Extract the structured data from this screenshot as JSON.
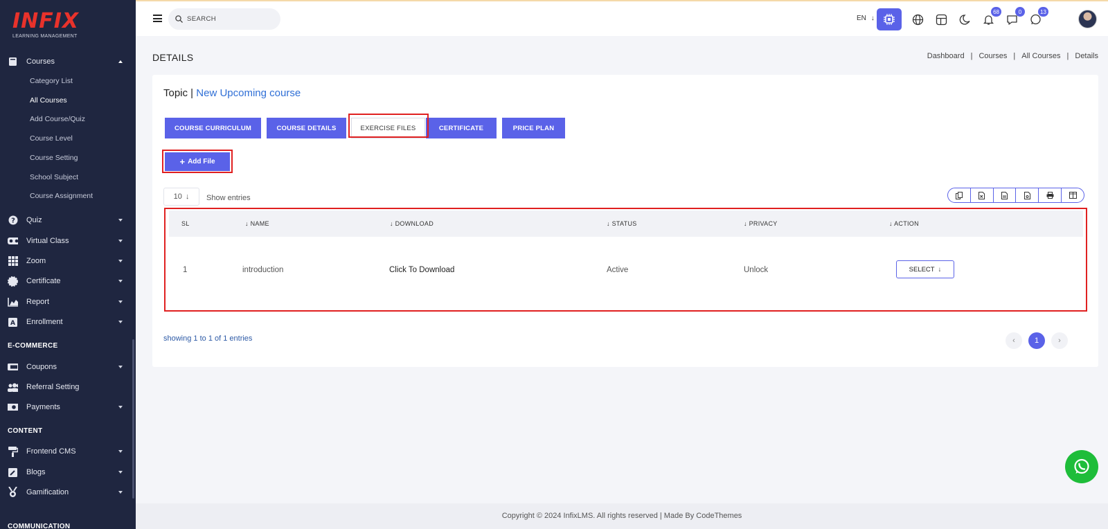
{
  "brand": {
    "logo_text": "INFIX",
    "logo_sub": "LEARNING MANAGEMENT"
  },
  "sidebar": {
    "courses": {
      "label": "Courses",
      "icon": "book-icon"
    },
    "course_sub": [
      "Category List",
      "All Courses",
      "Add Course/Quiz",
      "Course Level",
      "Course Setting",
      "School Subject",
      "Course Assignment"
    ],
    "active_sub": "All Courses",
    "items": [
      {
        "label": "Quiz",
        "icon": "question-icon"
      },
      {
        "label": "Virtual Class",
        "icon": "vr-icon"
      },
      {
        "label": "Zoom",
        "icon": "grid-icon"
      },
      {
        "label": "Certificate",
        "icon": "badge-icon"
      },
      {
        "label": "Report",
        "icon": "chart-icon"
      },
      {
        "label": "Enrollment",
        "icon": "enroll-icon"
      }
    ],
    "ecommerce_title": "E-COMMERCE",
    "ecommerce": [
      {
        "label": "Coupons",
        "icon": "ticket-icon"
      },
      {
        "label": "Referral Setting",
        "icon": "users-icon"
      },
      {
        "label": "Payments",
        "icon": "money-icon"
      }
    ],
    "content_title": "CONTENT",
    "content": [
      {
        "label": "Frontend CMS",
        "icon": "paint-roller-icon"
      },
      {
        "label": "Blogs",
        "icon": "edit-icon"
      },
      {
        "label": "Gamification",
        "icon": "medal-icon"
      }
    ],
    "communication_title": "COMMUNICATION"
  },
  "header": {
    "search_placeholder": "SEARCH",
    "lang": "EN",
    "notifications_count": "68",
    "messages_count": "0",
    "whatsapp_count": "13"
  },
  "page": {
    "title": "DETAILS",
    "breadcrumb": [
      "Dashboard",
      "Courses",
      "All Courses",
      "Details"
    ],
    "topic_prefix": "Topic |",
    "course_name": "New Upcoming course",
    "tabs": [
      "COURSE CURRICULUM",
      "COURSE DETAILS",
      "EXERCISE FILES",
      "CERTIFICATE",
      "PRICE PLAN"
    ],
    "active_tab": "EXERCISE FILES",
    "add_file": "Add File",
    "entries_value": "10",
    "show_entries": "Show entries",
    "table": {
      "headers": [
        "SL",
        "NAME",
        "DOWNLOAD",
        "STATUS",
        "PRIVACY",
        "ACTION"
      ],
      "rows": [
        {
          "sl": "1",
          "name": "introduction",
          "download": "Click To Download",
          "status": "Active",
          "privacy": "Unlock",
          "action": "SELECT"
        }
      ]
    },
    "showing": "showing 1 to 1 of 1 entries",
    "current_page": "1"
  },
  "footer": {
    "text": "Copyright © 2024 InfixLMS. All rights reserved | Made By CodeThemes"
  },
  "colors": {
    "accent": "#5a62e8",
    "sidebar": "#1f2640",
    "highlight": "#e02020",
    "whatsapp": "#1ebd3a"
  }
}
